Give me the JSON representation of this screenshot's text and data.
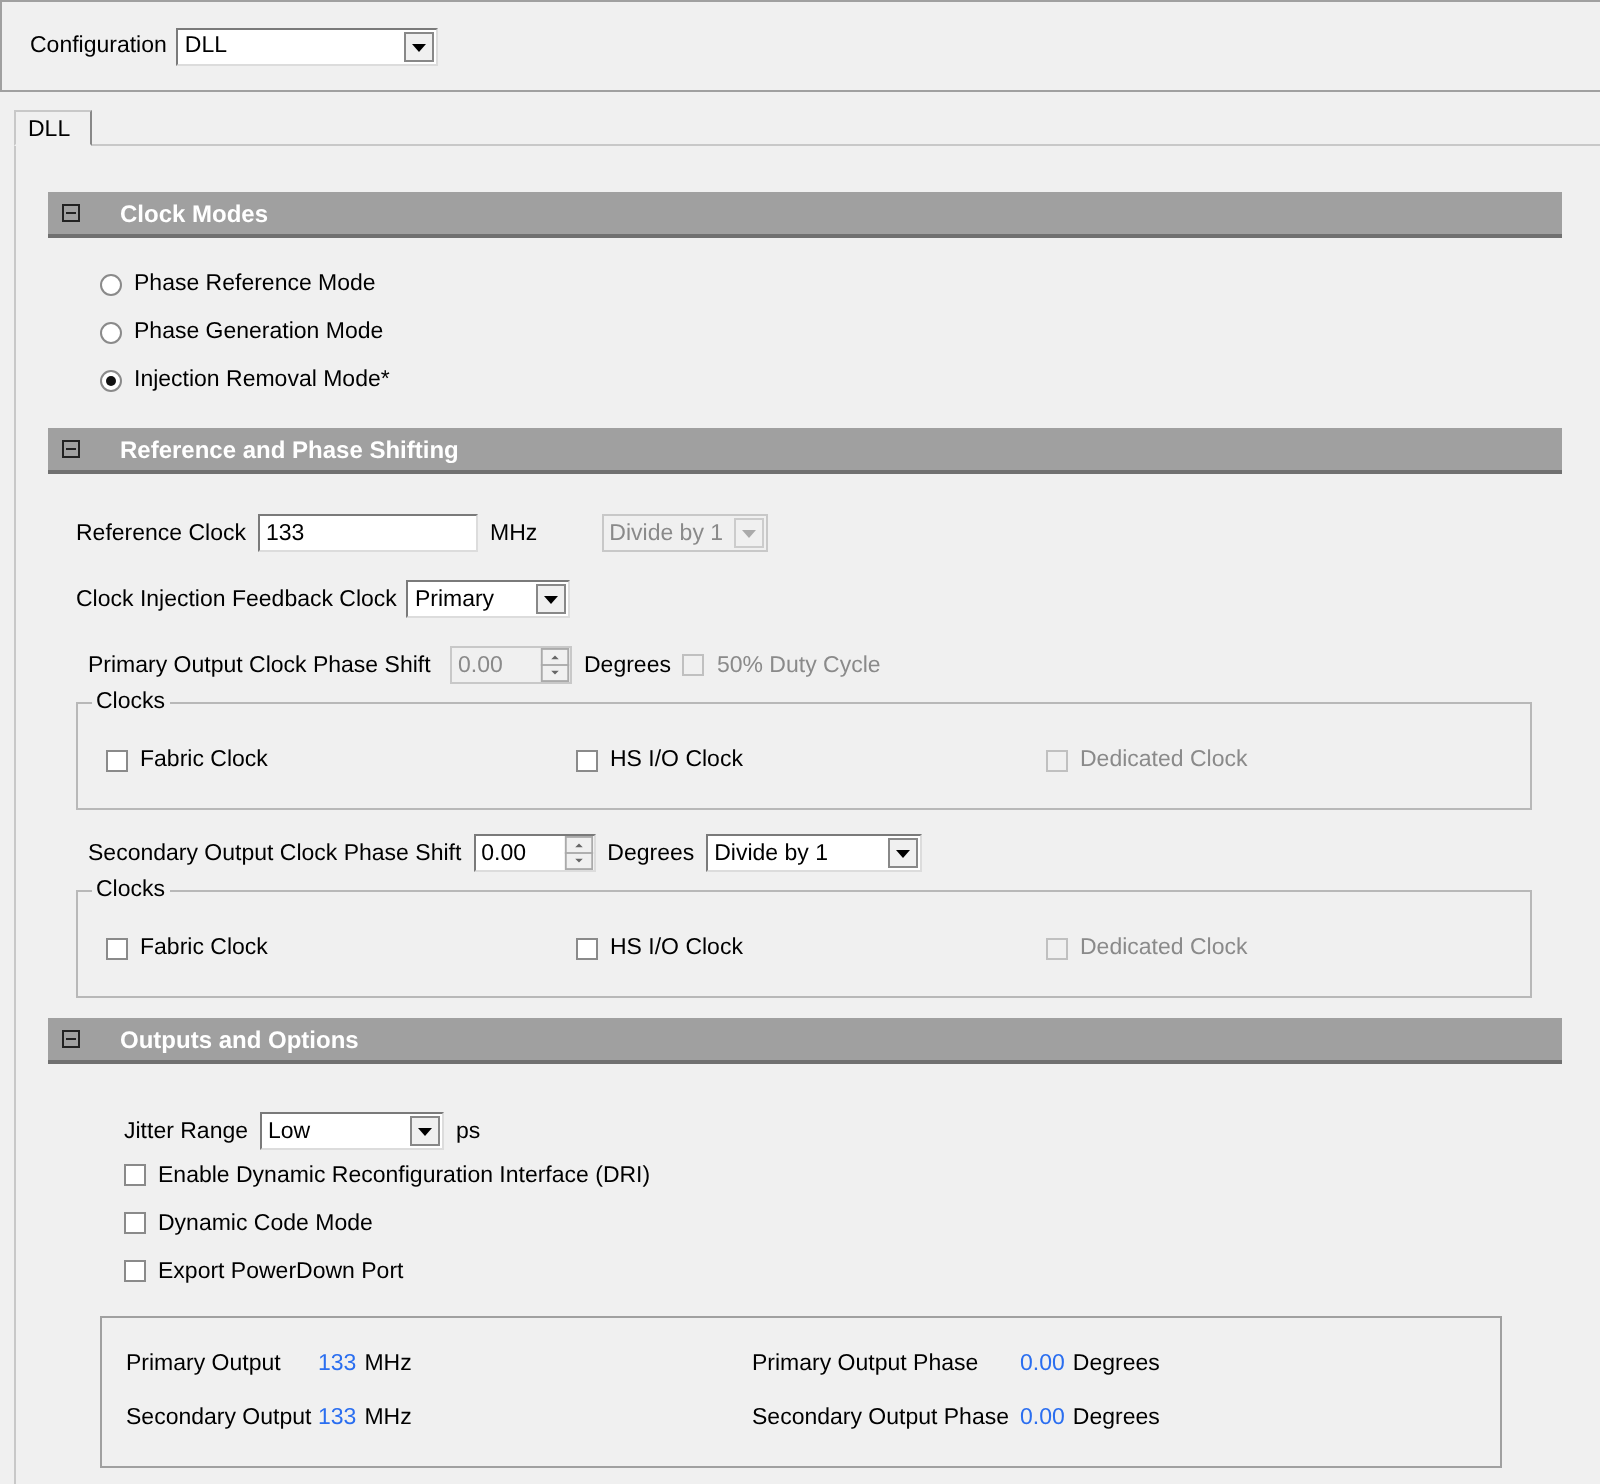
{
  "configuration": {
    "label": "Configuration",
    "value": "DLL"
  },
  "tabs": [
    {
      "label": "DLL",
      "selected": true
    }
  ],
  "clock_modes": {
    "title": "Clock Modes",
    "expanded": true,
    "options": [
      {
        "label": "Phase Reference Mode",
        "selected": false
      },
      {
        "label": "Phase Generation Mode",
        "selected": false
      },
      {
        "label": "Injection Removal Mode*",
        "selected": true
      }
    ]
  },
  "reference": {
    "title": "Reference and Phase Shifting",
    "expanded": true,
    "reference_clock": {
      "label": "Reference Clock",
      "value": "133",
      "unit": "MHz"
    },
    "divider": {
      "value": "Divide by 1",
      "disabled": true
    },
    "feedback": {
      "label": "Clock Injection Feedback Clock",
      "value": "Primary"
    },
    "primary_shift": {
      "label": "Primary Output Clock Phase Shift",
      "value": "0.00",
      "unit": "Degrees",
      "disabled": true
    },
    "duty_cycle": {
      "label": "50% Duty Cycle",
      "checked": false,
      "disabled": true
    },
    "primary_clocks": {
      "title": "Clocks",
      "items": [
        {
          "label": "Fabric Clock",
          "checked": false,
          "disabled": false
        },
        {
          "label": "HS I/O Clock",
          "checked": false,
          "disabled": false
        },
        {
          "label": "Dedicated Clock",
          "checked": false,
          "disabled": true
        }
      ]
    },
    "secondary_shift": {
      "label": "Secondary Output Clock Phase Shift",
      "value": "0.00",
      "unit": "Degrees",
      "disabled": false
    },
    "secondary_divider": {
      "value": "Divide by 1",
      "disabled": false
    },
    "secondary_clocks": {
      "title": "Clocks",
      "items": [
        {
          "label": "Fabric Clock",
          "checked": false,
          "disabled": false
        },
        {
          "label": "HS I/O Clock",
          "checked": false,
          "disabled": false
        },
        {
          "label": "Dedicated Clock",
          "checked": false,
          "disabled": true
        }
      ]
    }
  },
  "outputs": {
    "title": "Outputs and Options",
    "expanded": true,
    "jitter": {
      "label": "Jitter Range",
      "value": "Low",
      "unit": "ps"
    },
    "options": [
      {
        "label": "Enable Dynamic Reconfiguration Interface (DRI)",
        "checked": false
      },
      {
        "label": "Dynamic Code Mode",
        "checked": false
      },
      {
        "label": "Export PowerDown Port",
        "checked": false
      }
    ],
    "summary": [
      {
        "label": "Primary Output",
        "value": "133",
        "unit": "MHz"
      },
      {
        "label": "Primary Output Phase",
        "value": "0.00",
        "unit": "Degrees"
      },
      {
        "label": "Secondary Output",
        "value": "133",
        "unit": "MHz"
      },
      {
        "label": "Secondary Output Phase",
        "value": "0.00",
        "unit": "Degrees"
      }
    ]
  }
}
